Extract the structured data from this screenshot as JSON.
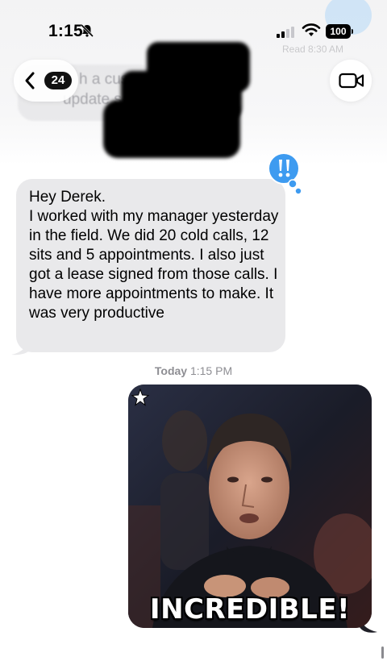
{
  "status_bar": {
    "time": "1:15",
    "battery": "100",
    "icons": [
      "bell-slash-icon",
      "cellular-signal-icon",
      "wifi-icon",
      "battery-icon"
    ]
  },
  "header": {
    "back_badge": "24",
    "ghost_text_line1": "h a custo",
    "ghost_text_line2": "update s",
    "read_receipt": "Read 8:30 AM",
    "icons": [
      "chevron-left-icon",
      "video-camera-icon"
    ]
  },
  "received_message": {
    "text": "Hey Derek.\nI worked with my manager yesterday in the field.  We did 20 cold calls, 12 sits and 5 appointments. I also just  got a lease signed from those calls. I have more appointments to make. It was very productive",
    "tapback_icon": "double-exclamation-icon"
  },
  "timestamp": {
    "day": "Today",
    "time": "1:15 PM"
  },
  "sent_gif": {
    "caption": "INCREDIBLE!",
    "icon": "star-icon"
  },
  "colors": {
    "received_bubble": "#e9e9eb",
    "tapback_blue": "#3e9bf0",
    "timestamp_gray": "#8e8e93"
  }
}
